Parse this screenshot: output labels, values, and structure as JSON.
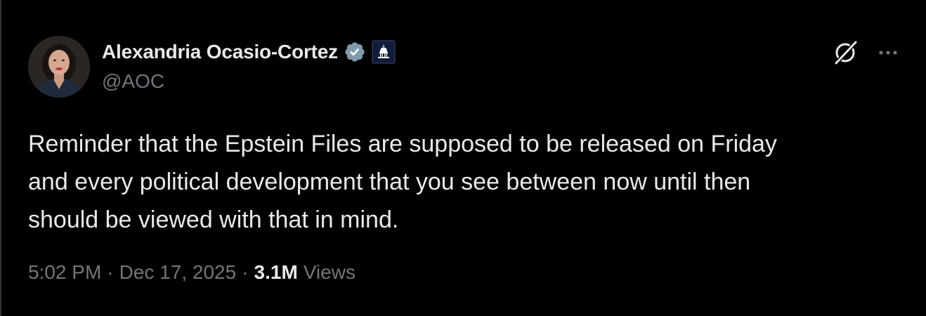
{
  "tweet": {
    "author": {
      "display_name": "Alexandria Ocasio-Cortez",
      "handle": "@AOC",
      "verified_icon": "verified-badge-icon",
      "affiliation_icon": "capitol-government-badge-icon"
    },
    "actions": {
      "grok_icon": "grok-icon",
      "more_icon": "more-options-icon"
    },
    "text_lines": [
      "Reminder that the Epstein Files are supposed to be released on Friday",
      "and every political development that you see between now until then",
      "should be viewed with that in mind."
    ],
    "meta": {
      "time": "5:02 PM",
      "separator": "·",
      "date": "Dec 17, 2025",
      "views_count": "3.1M",
      "views_label": "Views"
    }
  },
  "colors": {
    "background": "#000000",
    "primary_text": "#e7e9ea",
    "secondary_text": "#71767b",
    "verified_badge": "#829aab"
  }
}
